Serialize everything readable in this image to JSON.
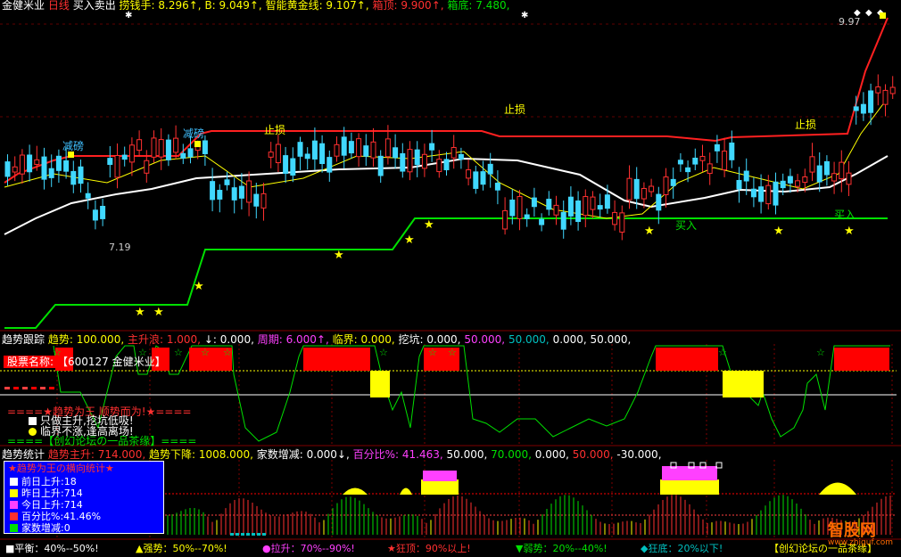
{
  "header": {
    "stock_name": "金健米业",
    "period": "日线",
    "indicator": "买入卖出",
    "items": [
      {
        "label": "捞钱手",
        "value": "8.296↑",
        "color": "#ffff00"
      },
      {
        "label": "B",
        "value": "9.049↑",
        "color": "#ffff00"
      },
      {
        "label": "智能黄金线",
        "value": "9.107↑",
        "color": "#ffff00"
      },
      {
        "label": "箱顶",
        "value": "9.900↑",
        "color": "#ff3030"
      },
      {
        "label": "箱底",
        "value": "7.480",
        "color": "#00e000"
      }
    ]
  },
  "main_chart": {
    "high_label": "9.97",
    "low_label": "7.19",
    "labels": {
      "jianbang1": "减磅",
      "jianbang2": "减磅",
      "zhisun1": "止损",
      "zhisun2": "止损",
      "zhisun3": "止损",
      "mairu1": "买入",
      "mairu2": "买入"
    }
  },
  "trend_panel": {
    "title": "趋势跟踪",
    "items": [
      {
        "label": "趋势",
        "value": "100.000",
        "color": "#ffff00"
      },
      {
        "label": "主升浪",
        "value": "1.000",
        "color": "#ff3030"
      },
      {
        "label": "↓",
        "value": "0.000",
        "color": "#ffffff"
      },
      {
        "label": "周期",
        "value": "6.000↑",
        "color": "#ff40ff"
      },
      {
        "label": "临界",
        "value": "0.000",
        "color": "#ffff00"
      },
      {
        "label": "挖坑",
        "value": "0.000",
        "color": "#ffffff"
      },
      {
        "label": "",
        "value": "50.000",
        "color": "#ff40ff"
      },
      {
        "label": "",
        "value": "50.000",
        "color": "#00c0c0"
      },
      {
        "label": "",
        "value": "0.000",
        "color": "#ffffff"
      },
      {
        "label": "",
        "value": "50.000",
        "color": "#ffffff"
      }
    ],
    "stock_label": "股票名称:",
    "stock_value": "【600127 金健米业】",
    "slogan1": "====★趋势为王 顺势而为!★====",
    "slogan2": "只做主升,挖坑低吸!",
    "slogan3": "临界不涨,逢高离场!",
    "slogan4": "====【创幻论坛の一品茶缘】===="
  },
  "stats_panel": {
    "title": "趋势统计",
    "items": [
      {
        "label": "趋势主升",
        "value": "714.000",
        "color": "#ff3030"
      },
      {
        "label": "趋势下降",
        "value": "1008.000",
        "color": "#ffff00"
      },
      {
        "label": "家数增减",
        "value": "0.000↓",
        "color": "#ffffff"
      },
      {
        "label": "百分比%",
        "value": "41.463",
        "color": "#ff40ff"
      },
      {
        "label": "",
        "value": "50.000",
        "color": "#ffffff"
      },
      {
        "label": "",
        "value": "70.000",
        "color": "#00e000"
      },
      {
        "label": "",
        "value": "0.000",
        "color": "#ffffff"
      },
      {
        "label": "",
        "value": "50.000",
        "color": "#ff3030"
      },
      {
        "label": "",
        "value": "-30.000",
        "color": "#ffffff"
      }
    ],
    "box_title": "★趋势为王の横向统计★",
    "box_rows": [
      {
        "label": "前日上升:",
        "value": "18",
        "color": "#ffffff"
      },
      {
        "label": "昨日上升:",
        "value": "714",
        "color": "#ffff00"
      },
      {
        "label": "今日上升:",
        "value": "714",
        "color": "#ff40ff"
      },
      {
        "label": "百分比%:",
        "value": "41.46%",
        "color": "#ff3030"
      },
      {
        "label": "家数增减:",
        "value": "0",
        "color": "#00e000"
      }
    ]
  },
  "legend": [
    {
      "icon": "■",
      "text": "平衡：40%--50%!",
      "color": "#ffffff"
    },
    {
      "icon": "▲",
      "text": "强势：50%--70%!",
      "color": "#ffff00"
    },
    {
      "icon": "●",
      "text": "拉升：70%--90%!",
      "color": "#ff40ff"
    },
    {
      "icon": "★",
      "text": "狂顶：90%以上!",
      "color": "#ff3030"
    },
    {
      "icon": "▼",
      "text": "弱势：20%--40%!",
      "color": "#00e000"
    },
    {
      "icon": "◆",
      "text": "狂底：20%以下!",
      "color": "#00c0c0"
    },
    {
      "icon": "",
      "text": "【创幻论坛の一品茶缘】",
      "color": "#ffff00"
    }
  ],
  "watermark": {
    "brand": "智股网",
    "url": "www.zhiguf.com"
  }
}
